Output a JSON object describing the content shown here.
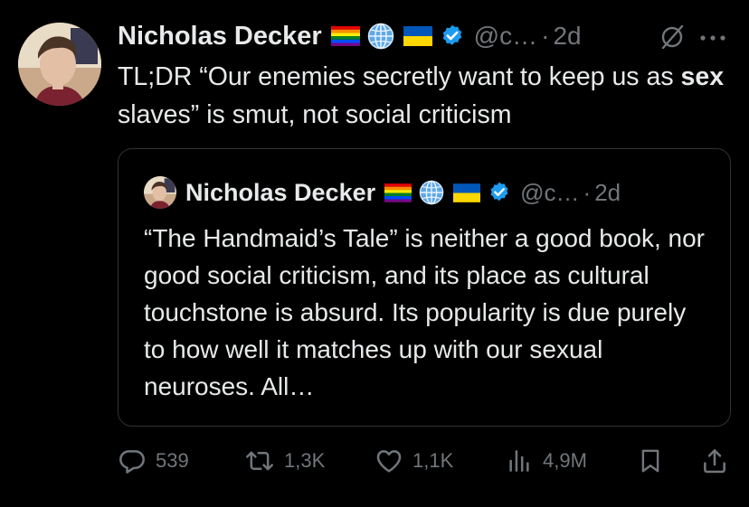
{
  "tweet": {
    "author": {
      "name": "Nicholas Decker",
      "handle": "@c…",
      "time": "2d",
      "separator": "·"
    },
    "text_parts": {
      "p1": "TL;DR “Our enemies secretly want to keep us as ",
      "bold": "sex",
      "p2": " slaves” is smut, not social criticism"
    },
    "quote": {
      "author": {
        "name": "Nicholas Decker",
        "handle": "@c…",
        "time": "2d",
        "separator": "·"
      },
      "text": "“The Handmaid’s Tale” is neither a good book, nor good social criticism, and its place as cultural touchstone is absurd. Its popularity is due purely to how well it matches up with our sexual neuroses. All…"
    },
    "metrics": {
      "replies": "539",
      "reposts": "1,3K",
      "likes": "1,1K",
      "views": "4,9M"
    }
  },
  "icons": {
    "verified": "verified-badge-icon",
    "grok": "grok-icon",
    "more": "more-icon",
    "reply": "reply-icon",
    "retweet": "retweet-icon",
    "like": "heart-icon",
    "views": "views-icon",
    "bookmark": "bookmark-icon",
    "share": "share-icon"
  },
  "colors": {
    "background": "#000000",
    "text": "#e7e9ea",
    "muted": "#71767b",
    "verified": "#1d9bf0",
    "border": "#2f3336"
  }
}
